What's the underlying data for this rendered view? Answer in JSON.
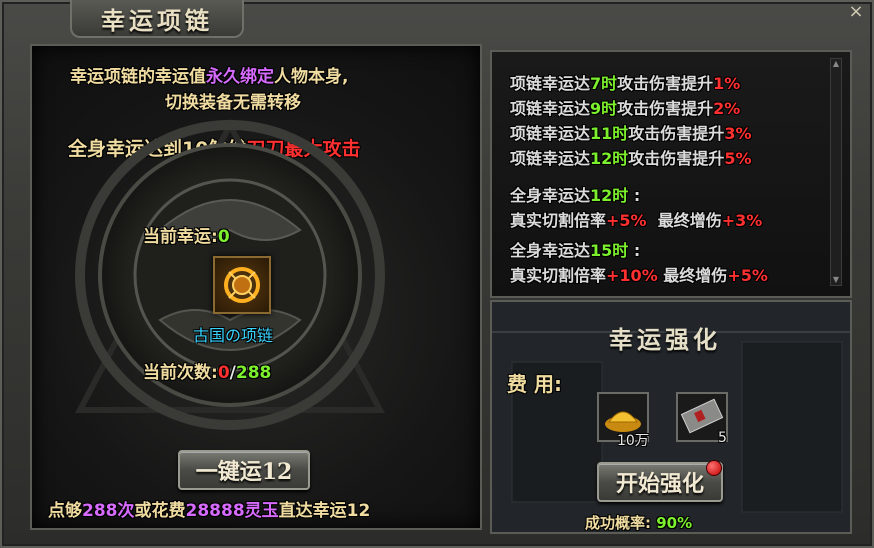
{
  "window": {
    "title": "幸运项链",
    "close_label": "×"
  },
  "left": {
    "desc_line1_a": "幸运项链的幸运值",
    "desc_line1_b": "永久绑定",
    "desc_line1_c": "人物本身,",
    "desc_line2": "切换装备无需转移",
    "trigger_a": "全身幸运达到",
    "trigger_b": "10",
    "trigger_c": "触发",
    "trigger_d": "刀刀最大攻击",
    "current_luck_label": "当前幸运:",
    "current_luck_value": "0",
    "item_name": "古国の项链",
    "current_count_label": "当前次数:",
    "current_count_value": "0",
    "count_sep": "/",
    "count_max": "288",
    "one_click_button": "一键运12",
    "footer_a": "点够",
    "footer_b": "288次",
    "footer_c": "或花费",
    "footer_d": "28888灵玉",
    "footer_e": "直达幸运12"
  },
  "right_top": {
    "lines": [
      {
        "a": "项链幸运达",
        "b": "7时",
        "c": "攻击伤害提升",
        "d": "1%"
      },
      {
        "a": "项链幸运达",
        "b": "9时",
        "c": "攻击伤害提升",
        "d": "2%"
      },
      {
        "a": "项链幸运达",
        "b": "11时",
        "c": "攻击伤害提升",
        "d": "3%"
      },
      {
        "a": "项链幸运达",
        "b": "12时",
        "c": "攻击伤害提升",
        "d": "5%"
      }
    ],
    "tier1_a": "全身幸运达",
    "tier1_b": "12时",
    "tier1_c": ":",
    "tier1_stat_a": "真实切割倍率",
    "tier1_stat_b": "+5%",
    "tier1_stat_c": "最终增伤",
    "tier1_stat_d": "+3%",
    "tier2_a": "全身幸运达",
    "tier2_b": "15时",
    "tier2_c": ":",
    "tier2_stat_a": "真实切割倍率",
    "tier2_stat_b": "+10%",
    "tier2_stat_c": "最终增伤",
    "tier2_stat_d": "+5%"
  },
  "right_bottom": {
    "section_title": "幸运强化",
    "cost_label": "费 用:",
    "cost_gold_qty": "10万",
    "cost_item_qty": "5",
    "start_button": "开始强化",
    "success_label": "成功概率:",
    "success_value": "90%"
  },
  "colors": {
    "accent_red": "#ff3030",
    "accent_green": "#7cf02c",
    "accent_purple": "#d86bff",
    "text_gold": "#f0dca0",
    "item_cyan": "#39d4ff"
  }
}
